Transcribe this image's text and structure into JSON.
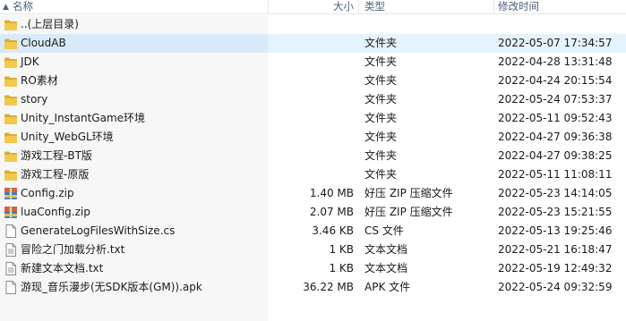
{
  "header": {
    "name": "名称",
    "size": "大小",
    "type": "类型",
    "date": "修改时间"
  },
  "rows": [
    {
      "name": "..(上层目录)",
      "size": "",
      "type": "",
      "date": "",
      "icon": "folder-icon"
    },
    {
      "name": "CloudAB",
      "size": "",
      "type": "文件夹",
      "date": "2022-05-07 17:34:57",
      "icon": "folder-icon"
    },
    {
      "name": "JDK",
      "size": "",
      "type": "文件夹",
      "date": "2022-04-28 13:31:48",
      "icon": "folder-icon"
    },
    {
      "name": "RO素材",
      "size": "",
      "type": "文件夹",
      "date": "2022-04-24 20:15:54",
      "icon": "folder-icon"
    },
    {
      "name": "story",
      "size": "",
      "type": "文件夹",
      "date": "2022-05-24 07:53:37",
      "icon": "folder-icon"
    },
    {
      "name": "Unity_InstantGame环境",
      "size": "",
      "type": "文件夹",
      "date": "2022-05-11 09:52:43",
      "icon": "folder-icon"
    },
    {
      "name": "Unity_WebGL环境",
      "size": "",
      "type": "文件夹",
      "date": "2022-04-27 09:36:38",
      "icon": "folder-icon"
    },
    {
      "name": "游戏工程-BT版",
      "size": "",
      "type": "文件夹",
      "date": "2022-04-27 09:38:25",
      "icon": "folder-icon"
    },
    {
      "name": "游戏工程-原版",
      "size": "",
      "type": "文件夹",
      "date": "2022-05-11 11:08:11",
      "icon": "folder-icon"
    },
    {
      "name": "Config.zip",
      "size": "1.40 MB",
      "type": "好压 ZIP 压缩文件",
      "date": "2022-05-23 14:14:05",
      "icon": "zip-archive-icon"
    },
    {
      "name": "luaConfig.zip",
      "size": "2.07 MB",
      "type": "好压 ZIP 压缩文件",
      "date": "2022-05-23 15:21:55",
      "icon": "zip-archive-icon"
    },
    {
      "name": "GenerateLogFilesWithSize.cs",
      "size": "3.46 KB",
      "type": "CS 文件",
      "date": "2022-05-13 19:25:46",
      "icon": "file-icon"
    },
    {
      "name": "冒险之门加载分析.txt",
      "size": "1 KB",
      "type": "文本文档",
      "date": "2022-05-21 16:18:47",
      "icon": "text-file-icon"
    },
    {
      "name": "新建文本文档.txt",
      "size": "1 KB",
      "type": "文本文档",
      "date": "2022-05-19 12:49:32",
      "icon": "text-file-icon"
    },
    {
      "name": "游现_音乐漫步(无SDK版本(GM)).apk",
      "size": "36.22 MB",
      "type": "APK 文件",
      "date": "2022-05-24 09:32:59",
      "icon": "file-icon"
    }
  ],
  "selected_index": 1,
  "colors": {
    "folder": "#f2c94c",
    "folder_dark": "#dcae2f",
    "selection": "#e5f3ff",
    "header_text": "#4c607a"
  }
}
